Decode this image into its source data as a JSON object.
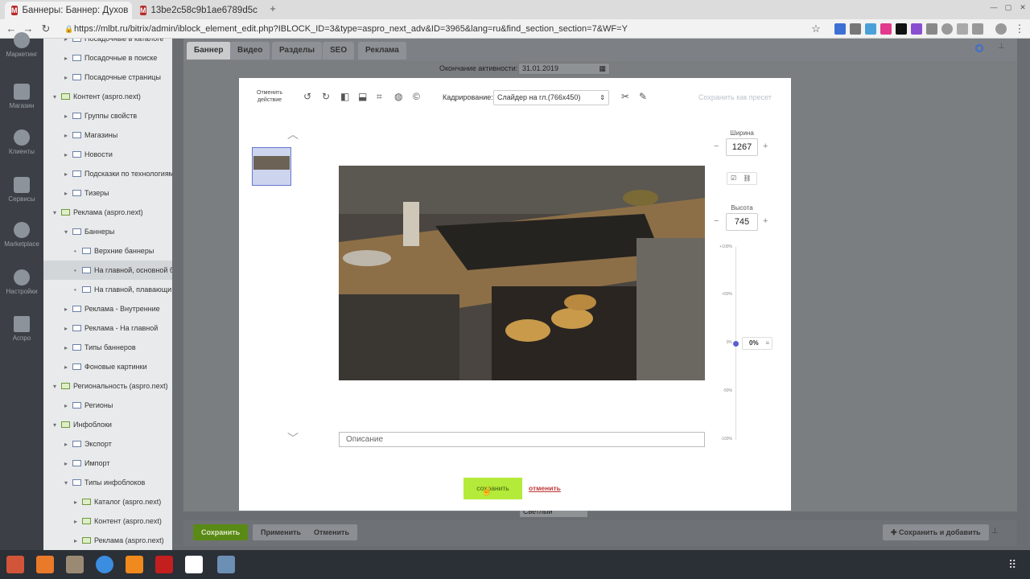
{
  "browser": {
    "tabs": [
      {
        "title": "Баннеры: Баннер: Духов",
        "favicon": "М",
        "active": true
      },
      {
        "title": "13be2c58c9b1ae6789d5c",
        "favicon": "М",
        "active": false
      }
    ],
    "url": "https://mlbt.ru/bitrix/admin/iblock_element_edit.php?IBLOCK_ID=3&type=aspro_next_adv&ID=3965&lang=ru&find_section_section=7&WF=Y"
  },
  "sidebar": {
    "items": [
      {
        "label": "Маркетинг",
        "icon": "target-icon"
      },
      {
        "label": "Магазин",
        "icon": "basket-icon"
      },
      {
        "label": "Клиенты",
        "icon": "clients-icon"
      },
      {
        "label": "Сервисы",
        "icon": "layers-icon"
      },
      {
        "label": "Marketplace",
        "icon": "cloud-download-icon"
      },
      {
        "label": "Настройки",
        "icon": "gear-icon"
      },
      {
        "label": "Аспро",
        "icon": "letter-a-icon"
      }
    ]
  },
  "tree": [
    {
      "label": "Посадочные в каталоге",
      "level": 2,
      "arrow": "▸"
    },
    {
      "label": "Посадочные в поиске",
      "level": 2,
      "arrow": "▸"
    },
    {
      "label": "Посадочные страницы",
      "level": 2,
      "arrow": "▸"
    },
    {
      "label": "Контент (aspro.next)",
      "level": 1,
      "arrow": "▾",
      "green": true
    },
    {
      "label": "Группы свойств",
      "level": 2,
      "arrow": "▸"
    },
    {
      "label": "Магазины",
      "level": 2,
      "arrow": "▸"
    },
    {
      "label": "Новости",
      "level": 2,
      "arrow": "▸"
    },
    {
      "label": "Подсказки по технологиям",
      "level": 2,
      "arrow": "▸"
    },
    {
      "label": "Тизеры",
      "level": 2,
      "arrow": "▸"
    },
    {
      "label": "Реклама (aspro.next)",
      "level": 1,
      "arrow": "▾",
      "green": true
    },
    {
      "label": "Баннеры",
      "level": 2,
      "arrow": "▾"
    },
    {
      "label": "Верхние баннеры",
      "level": 3,
      "arrow": "•"
    },
    {
      "label": "На главной, основной б",
      "level": 3,
      "arrow": "•",
      "selected": true
    },
    {
      "label": "На главной, плавающи",
      "level": 3,
      "arrow": "•"
    },
    {
      "label": "Реклама - Внутренние",
      "level": 2,
      "arrow": "▸"
    },
    {
      "label": "Реклама - На главной",
      "level": 2,
      "arrow": "▸"
    },
    {
      "label": "Типы баннеров",
      "level": 2,
      "arrow": "▸"
    },
    {
      "label": "Фоновые картинки",
      "level": 2,
      "arrow": "▸"
    },
    {
      "label": "Региональность (aspro.next)",
      "level": 1,
      "arrow": "▾",
      "green": true
    },
    {
      "label": "Регионы",
      "level": 2,
      "arrow": "▸"
    },
    {
      "label": "Инфоблоки",
      "level": 1,
      "arrow": "▾",
      "green": true
    },
    {
      "label": "Экспорт",
      "level": 2,
      "arrow": "▸"
    },
    {
      "label": "Импорт",
      "level": 2,
      "arrow": "▸"
    },
    {
      "label": "Типы инфоблоков",
      "level": 2,
      "arrow": "▾"
    },
    {
      "label": "Каталог (aspro.next)",
      "level": 3,
      "arrow": "▸",
      "green": true
    },
    {
      "label": "Контент (aspro.next)",
      "level": 3,
      "arrow": "▸",
      "green": true
    },
    {
      "label": "Реклама (aspro.next)",
      "level": 3,
      "arrow": "▸",
      "green": true
    }
  ],
  "page": {
    "tabs": [
      "Баннер",
      "Видео",
      "Разделы",
      "SEO",
      "Реклама"
    ],
    "active_end_label": "Окончание активности:",
    "active_end_value": "31.01.2019",
    "select_value": "Светлый",
    "buttons": {
      "save": "Сохранить",
      "apply": "Применить",
      "cancel": "Отменить",
      "save_add": "Сохранить и добавить"
    }
  },
  "editor": {
    "undo_label": "Отменить действие",
    "crop_label": "Кадрирование:",
    "crop_value": "Слайдер на гл.(766x450)",
    "save_preset": "Сохранить как пресет",
    "width_label": "Ширина",
    "width_value": "1267",
    "height_label": "Высота",
    "height_value": "745",
    "brightness_value": "0%",
    "brightness_level": 0,
    "scale_labels": [
      "+100%",
      "+50%",
      "0%",
      "-50%",
      "-100%"
    ],
    "description_placeholder": "Описание",
    "save_button": "сохранить",
    "cancel_button": "отменить"
  }
}
